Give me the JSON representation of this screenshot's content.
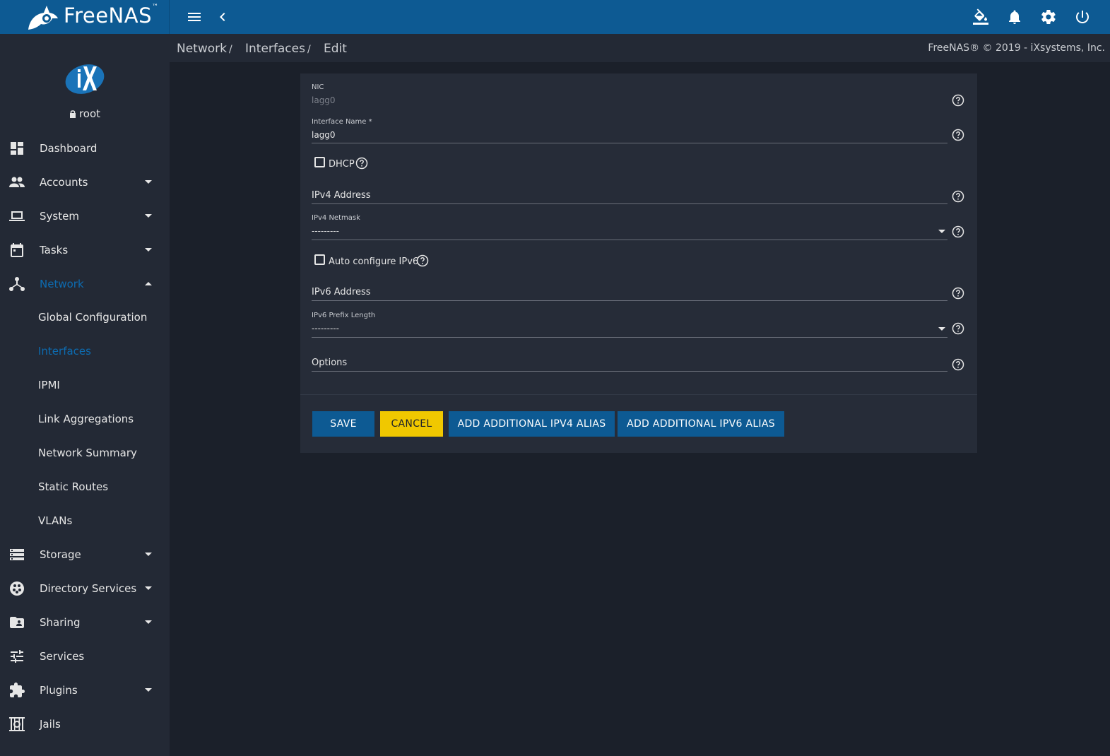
{
  "app": {
    "brand": "FreeNAS",
    "brand_tm": "™"
  },
  "topbar": {
    "icons": [
      "menu-icon",
      "back-chevron-icon",
      "theme-paint-icon",
      "bell-icon",
      "settings-gear-icon",
      "power-icon"
    ]
  },
  "sidebar": {
    "user": "root",
    "items": [
      {
        "label": "Dashboard",
        "icon": "dashboard-icon"
      },
      {
        "label": "Accounts",
        "icon": "people-icon"
      },
      {
        "label": "System",
        "icon": "laptop-icon"
      },
      {
        "label": "Tasks",
        "icon": "calendar-icon"
      },
      {
        "label": "Network",
        "icon": "network-icon"
      },
      {
        "label": "Storage",
        "icon": "storage-icon"
      },
      {
        "label": "Directory Services",
        "icon": "directory-icon"
      },
      {
        "label": "Sharing",
        "icon": "sharing-folder-icon"
      },
      {
        "label": "Services",
        "icon": "tune-icon"
      },
      {
        "label": "Plugins",
        "icon": "puzzle-icon"
      },
      {
        "label": "Jails",
        "icon": "jail-icon"
      }
    ],
    "network_sub": [
      {
        "label": "Global Configuration"
      },
      {
        "label": "Interfaces"
      },
      {
        "label": "IPMI"
      },
      {
        "label": "Link Aggregations"
      },
      {
        "label": "Network Summary"
      },
      {
        "label": "Static Routes"
      },
      {
        "label": "VLANs"
      }
    ]
  },
  "breadcrumb": {
    "items": [
      "Network",
      "Interfaces",
      "Edit"
    ],
    "separator": "/",
    "copyright": "FreeNAS® © 2019 - iXsystems, Inc."
  },
  "form": {
    "nic_label": "NIC",
    "nic_value": "lagg0",
    "name_label": "Interface Name  *",
    "name_value": "lagg0",
    "dhcp_label": "DHCP",
    "dhcp_checked": false,
    "ipv4_address_label": "IPv4 Address",
    "ipv4_netmask_label": "IPv4 Netmask",
    "ipv4_netmask_value": "---------",
    "auto_ipv6_label": "Auto configure IPv6",
    "auto_ipv6_checked": false,
    "ipv6_address_label": "IPv6 Address",
    "ipv6_prefix_label": "IPv6 Prefix Length",
    "ipv6_prefix_value": "---------",
    "options_label": "Options"
  },
  "buttons": {
    "save": "SAVE",
    "cancel": "CANCEL",
    "add_ipv4": "ADD ADDITIONAL IPV4 ALIAS",
    "add_ipv6": "ADD ADDITIONAL IPV6 ALIAS"
  },
  "colors": {
    "topbar": "#0d5a93",
    "sidebar": "#232935",
    "background": "#1b202a",
    "card": "#262c38",
    "accent": "#0d6bb0",
    "cancel": "#f0c800"
  }
}
